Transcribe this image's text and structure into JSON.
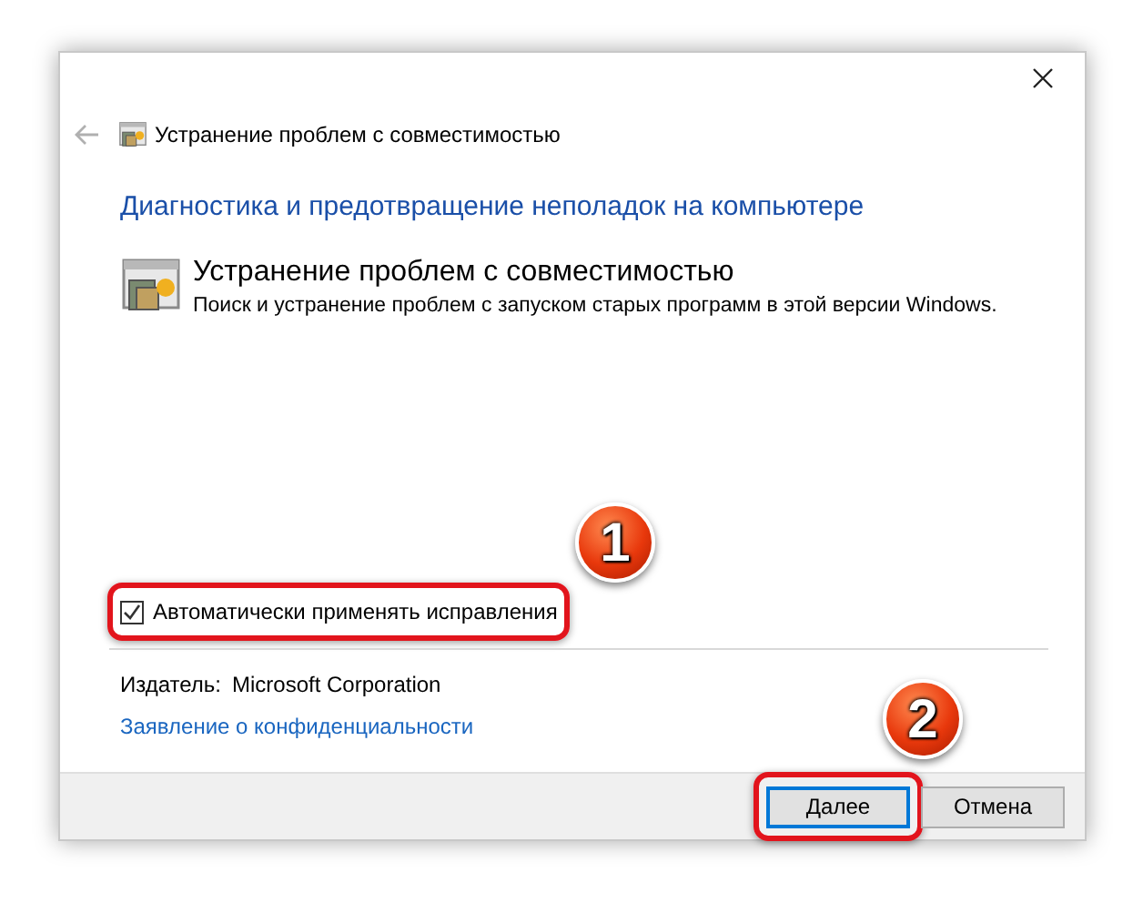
{
  "window": {
    "nav_title": "Устранение проблем с совместимостью"
  },
  "heading": "Диагностика и предотвращение неполадок на компьютере",
  "item": {
    "title": "Устранение проблем с совместимостью",
    "description": "Поиск и устранение проблем с запуском старых программ в этой версии Windows."
  },
  "checkbox": {
    "label": "Автоматически применять исправления",
    "checked": true,
    "highlighted": true
  },
  "publisher": {
    "label": "Издатель:",
    "value": "Microsoft Corporation"
  },
  "privacy_link": "Заявление о конфиденциальности",
  "buttons": [
    {
      "label": "Далее",
      "kind": "primary",
      "highlighted": true
    },
    {
      "label": "Отмена",
      "kind": "normal",
      "highlighted": false
    }
  ],
  "markers": [
    {
      "label": "1"
    },
    {
      "label": "2"
    }
  ]
}
